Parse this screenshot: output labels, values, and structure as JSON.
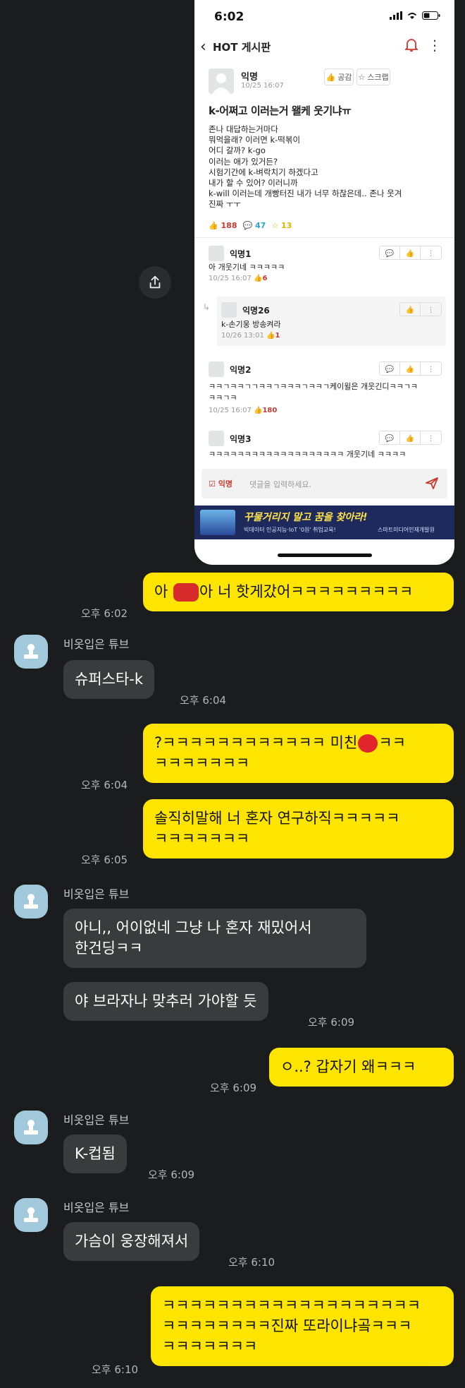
{
  "shared_image": {
    "status_time": "6:02",
    "nav": {
      "title": "HOT 게시판"
    },
    "post": {
      "author": "익명",
      "time": "10/25 16:07",
      "like_btn": "공감",
      "scrap_btn": "스크랩",
      "title": "k-어쩌고 이러는거 왤케 웃기냐ㅠ",
      "body": [
        "존나 대답하는거마다",
        "뭐먹을래? 이러면 k-떡볶이",
        "어디 갈까? k-go",
        "이러는 애가 있거든?",
        "시험기간에 k-벼락치기 하겠다고",
        "내가 할 수 있어? 이러니까",
        "k-will 이러는데 개빵터진 내가 너무 하찮은데.. 존나 웃겨",
        "진짜 ㅜㅜ"
      ],
      "likes": "188",
      "comments": "47",
      "scraps": "13"
    },
    "comments": [
      {
        "author": "익명1",
        "text": "아 개웃기네 ㅋㅋㅋㅋㅋ",
        "time": "10/25 16:07",
        "likes": "6"
      },
      {
        "author": "익명26",
        "text": "k-손기웅 방송켜라",
        "time": "10/26 13:01",
        "likes": "1"
      },
      {
        "author": "익명2",
        "text": "ㅋㅋㄱㅋㅋㄱㄱㅋㅋㄱㅋㅋㅋㄱㅋㅋㄱ케이윌은 개웃긴디ㅋㅋㄱㅋ",
        "text2": "ㅋㅋㄱㅋ",
        "time": "10/25 16:07",
        "likes": "180"
      },
      {
        "author": "익명3",
        "text": "ㅋㅋㅋㅋㅋㅋㅋㅋㅋㅋㅋㅋㅋㅋㅋㅋㅋㅋㅋ 개웃기네 ㅋㅋㅋㅋ"
      }
    ],
    "input": {
      "anon_label": "익명",
      "placeholder": "댓글을 입력하세요."
    },
    "ad": {
      "headline": "꾸물거리지 말고 꿈을 찾아라!",
      "sub": "빅데이터 인공지능·IoT '0원' 취업교육!",
      "brand": "스마트미디어인재개발원"
    }
  },
  "chat": {
    "other_name": "비옷입은 튜브",
    "messages": [
      {
        "from": "me",
        "lines": [
          "아",
          "아 너 핫게갔어ㅋㅋㅋㅋㅋㅋㅋㅋㅋ"
        ],
        "time": "오후 6:02"
      },
      {
        "from": "other",
        "lines": [
          "슈퍼스타-k"
        ],
        "time": "오후 6:04"
      },
      {
        "from": "me",
        "lines": [
          "?ㅋㅋㅋㅋㅋㅋㅋㅋㅋㅋㅋㅋ 미친",
          "ㅋㅋㅋㅋㅋㅋㅋ"
        ],
        "time": "오후 6:04"
      },
      {
        "from": "me",
        "lines": [
          "솔직히말해 너 혼자 연구하직ㅋㅋㅋㅋㅋ",
          "ㅋㅋㅋㅋㅋㅋㅋ"
        ],
        "time": "오후 6:05"
      },
      {
        "from": "other",
        "lines": [
          "아니,, 어이없네 그냥 나 혼자 재밌어서",
          "한건딩ㅋㅋ"
        ]
      },
      {
        "from": "other",
        "lines": [
          "야 브라자나 맞추러 가야할 듯"
        ],
        "time": "오후 6:09"
      },
      {
        "from": "me",
        "lines": [
          "ㅇ..? 갑자기 왜ㅋㅋㅋ"
        ],
        "time": "오후 6:09"
      },
      {
        "from": "other",
        "lines": [
          "K-컵됨"
        ],
        "time": "오후 6:09"
      },
      {
        "from": "other",
        "lines": [
          "가슴이 웅장해져서"
        ],
        "time": "오후 6:10"
      },
      {
        "from": "me",
        "lines": [
          "ㅋㅋㅋㅋㅋㅋㅋㅋㅋㅋㅋㅋㅋㅋㅋㅋㅋㅋㅋ",
          "ㅋㅋㅋㅋㅋㅋㅋㅋ진짜 또라이냐곸ㅋㅋㅋ",
          "ㅋㅋㅋㅋㅋㅋㅋ"
        ],
        "time": "오후 6:10"
      }
    ]
  },
  "colors": {
    "bg": "#1b1c1e",
    "my_bubble": "#fee500",
    "other_bubble": "#3a3b3d",
    "avatar": "#a2c8dc",
    "accent_red": "#c73a2f"
  }
}
